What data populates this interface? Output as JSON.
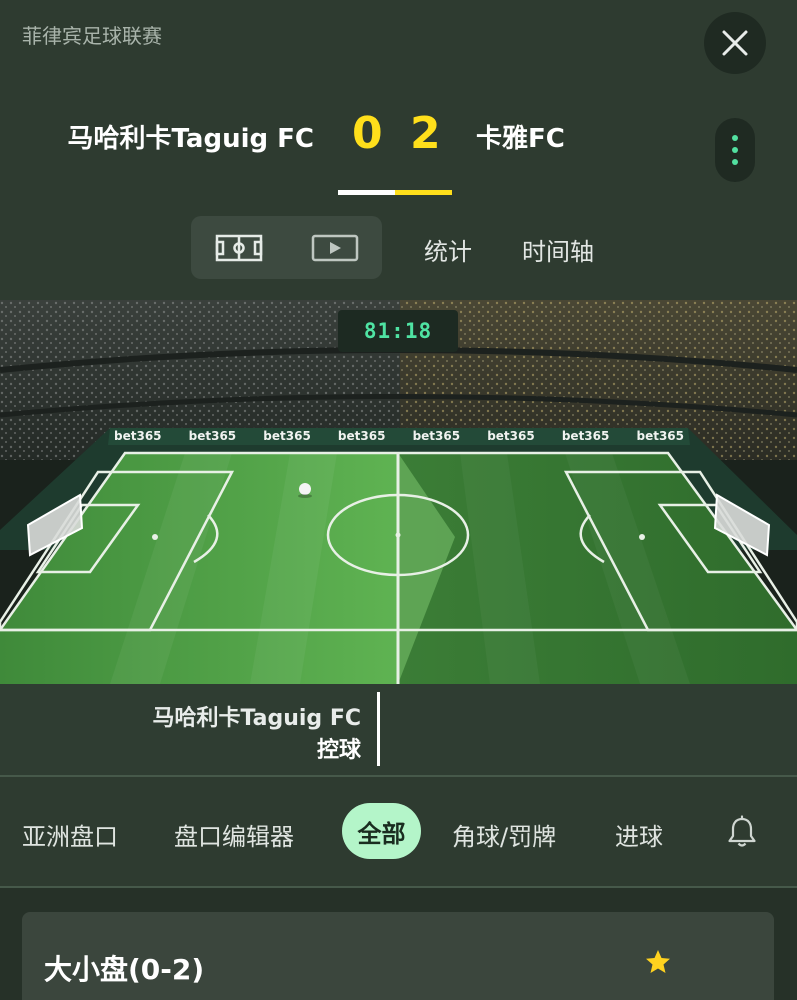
{
  "header": {
    "league": "菲律宾足球联赛",
    "home_team": "马哈利卡Taguig FC",
    "away_team": "卡雅FC",
    "home_score": "0",
    "away_score": "2",
    "tabs": [
      {
        "label": "统计"
      },
      {
        "label": "时间轴"
      }
    ]
  },
  "stadium": {
    "clock": "81:18",
    "board_text": "bet365"
  },
  "possession": {
    "team": "马哈利卡Taguig FC",
    "label": "控球"
  },
  "filters": {
    "items": [
      {
        "label": "亚洲盘口"
      },
      {
        "label": "盘口编辑器"
      },
      {
        "label": "全部"
      },
      {
        "label": "角球/罚牌"
      },
      {
        "label": "进球"
      }
    ],
    "selected": "全部"
  },
  "market": {
    "title": "大小盘(0-2)"
  },
  "colors": {
    "score": "#ffdf1b",
    "accent_green": "#4fe3a3",
    "selected_pill": "#b4f5c9",
    "star": "#ffd21f"
  },
  "icons": [
    "close-icon",
    "more-vertical-icon",
    "pitch-view-icon",
    "video-icon",
    "bell-icon",
    "star-icon"
  ]
}
